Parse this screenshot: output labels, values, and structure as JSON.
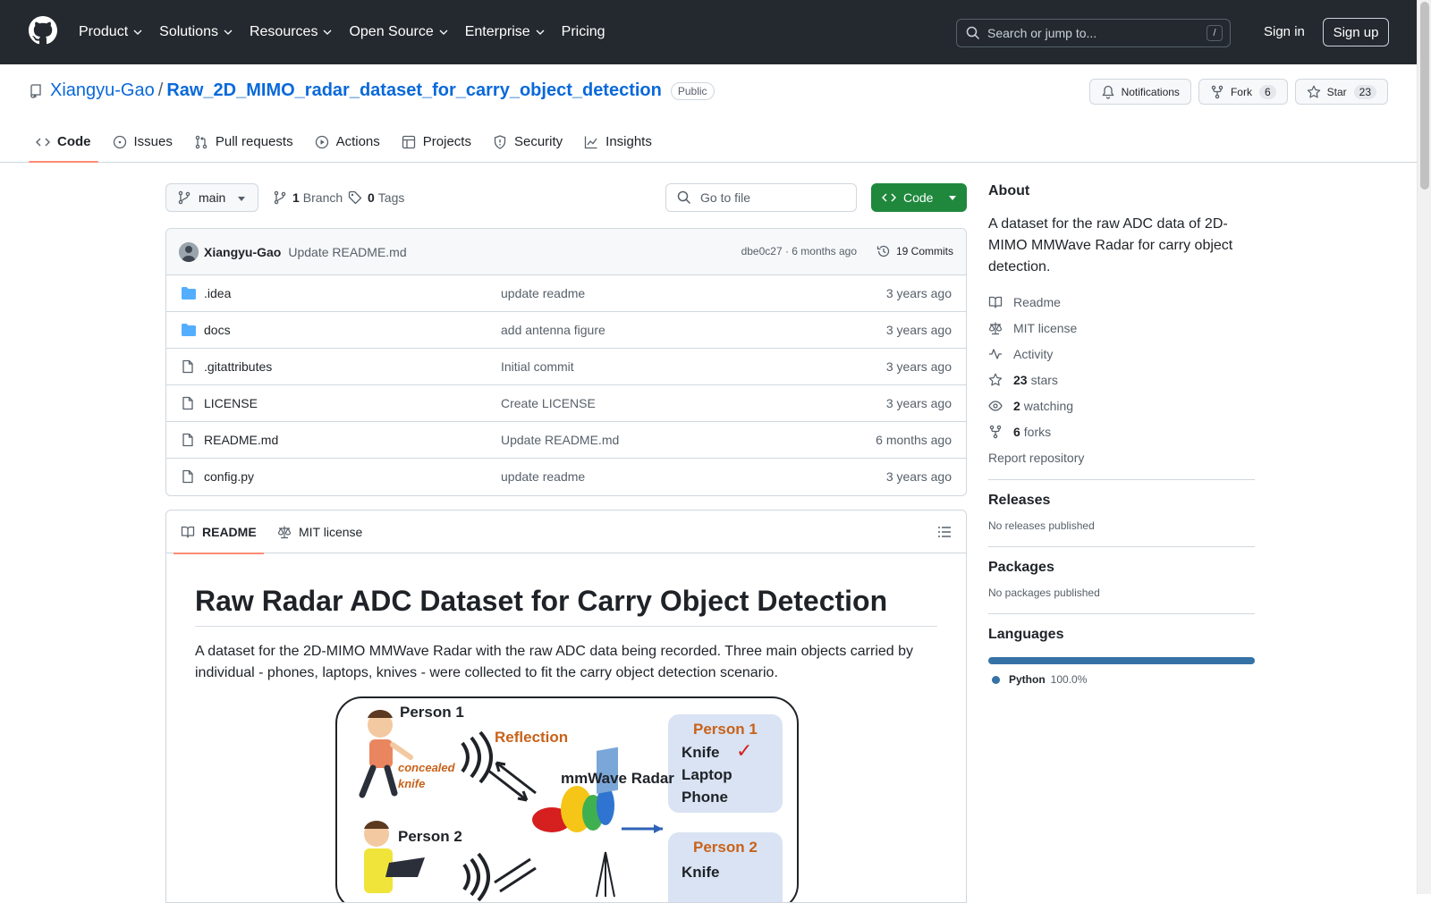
{
  "header": {
    "nav": [
      "Product",
      "Solutions",
      "Resources",
      "Open Source",
      "Enterprise",
      "Pricing"
    ],
    "search_placeholder": "Search or jump to...",
    "search_shortcut": "/",
    "signin": "Sign in",
    "signup": "Sign up"
  },
  "repo": {
    "owner": "Xiangyu-Gao",
    "separator": "/",
    "name": "Raw_2D_MIMO_radar_dataset_for_carry_object_detection",
    "visibility": "Public",
    "notifications": "Notifications",
    "fork_label": "Fork",
    "fork_count": "6",
    "star_label": "Star",
    "star_count": "23"
  },
  "tabs": [
    "Code",
    "Issues",
    "Pull requests",
    "Actions",
    "Projects",
    "Security",
    "Insights"
  ],
  "toolbar": {
    "branch": "main",
    "branch_count": "1",
    "branch_label": "Branch",
    "tag_count": "0",
    "tag_label": "Tags",
    "go_to_file": "Go to file",
    "code_button": "Code"
  },
  "commit": {
    "author": "Xiangyu-Gao",
    "message": "Update README.md",
    "hash_age": "dbe0c27 · 6 months ago",
    "commits": "19 Commits"
  },
  "files": [
    {
      "name": ".idea",
      "type": "folder",
      "message": "update readme",
      "age": "3 years ago"
    },
    {
      "name": "docs",
      "type": "folder",
      "message": "add antenna figure",
      "age": "3 years ago"
    },
    {
      "name": ".gitattributes",
      "type": "file",
      "message": "Initial commit",
      "age": "3 years ago"
    },
    {
      "name": "LICENSE",
      "type": "file",
      "message": "Create LICENSE",
      "age": "3 years ago"
    },
    {
      "name": "README.md",
      "type": "file",
      "message": "Update README.md",
      "age": "6 months ago"
    },
    {
      "name": "config.py",
      "type": "file",
      "message": "update readme",
      "age": "3 years ago"
    }
  ],
  "readme": {
    "tab_readme": "README",
    "tab_license": "MIT license",
    "title": "Raw Radar ADC Dataset for Carry Object Detection",
    "paragraph": "A dataset for the 2D-MIMO MMWave Radar with the raw ADC data being recorded. Three main objects carried by individual - phones, laptops, knives - were collected to fit the carry object detection scenario.",
    "figure": {
      "person1": "Person 1",
      "reflection": "Reflection",
      "concealed": "concealed",
      "knife_small": "knife",
      "radar": "mmWave Radar",
      "person2": "Person 2",
      "box1_title": "Person 1",
      "box1_items": [
        "Knife",
        "Laptop",
        "Phone"
      ],
      "check": "✓",
      "box2_title": "Person 2",
      "box2_item": "Knife"
    }
  },
  "about": {
    "title": "About",
    "description": "A dataset for the raw ADC data of 2D-MIMO MMWave Radar for carry object detection.",
    "readme": "Readme",
    "license": "MIT license",
    "activity": "Activity",
    "stars_count": "23",
    "stars_label": "stars",
    "watching_count": "2",
    "watching_label": "watching",
    "forks_count": "6",
    "forks_label": "forks",
    "report": "Report repository"
  },
  "releases": {
    "title": "Releases",
    "empty": "No releases published"
  },
  "packages": {
    "title": "Packages",
    "empty": "No packages published"
  },
  "languages": {
    "title": "Languages",
    "name": "Python",
    "percent": "100.0%",
    "color": "#3572a5"
  }
}
